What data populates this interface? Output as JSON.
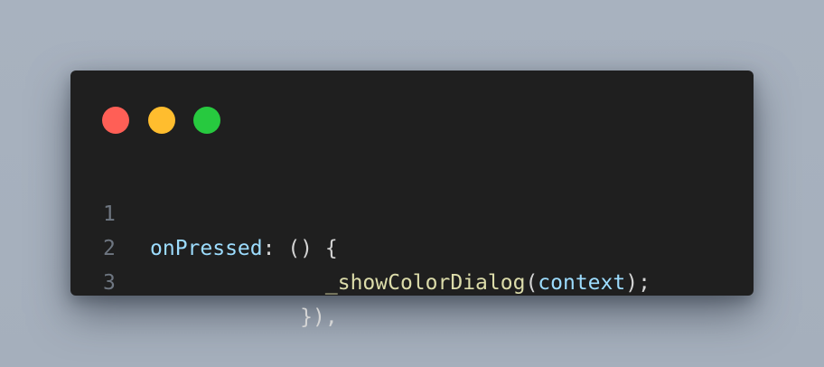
{
  "window": {
    "controls": [
      {
        "name": "close",
        "color": "#ff5f56"
      },
      {
        "name": "minimize",
        "color": "#ffbd2e"
      },
      {
        "name": "maximize",
        "color": "#27c93f"
      }
    ]
  },
  "code": {
    "lines": [
      {
        "number": "1",
        "indent": "",
        "tokens": [
          {
            "text": "onPressed",
            "kind": "prop"
          },
          {
            "text": ": () {",
            "kind": "punc"
          }
        ]
      },
      {
        "number": "2",
        "indent": "              ",
        "tokens": [
          {
            "text": "_showColorDialog",
            "kind": "fn"
          },
          {
            "text": "(",
            "kind": "punc"
          },
          {
            "text": "context",
            "kind": "var"
          },
          {
            "text": ");",
            "kind": "punc"
          }
        ]
      },
      {
        "number": "3",
        "indent": "            ",
        "tokens": [
          {
            "text": "}),",
            "kind": "punc"
          }
        ]
      }
    ]
  },
  "colors": {
    "background": "#a8b2bf",
    "editor": "#1f1f1f",
    "line_number": "#6e7681",
    "property": "#9cdcfe",
    "function": "#dcdcaa",
    "punctuation": "#d4d4d4"
  }
}
